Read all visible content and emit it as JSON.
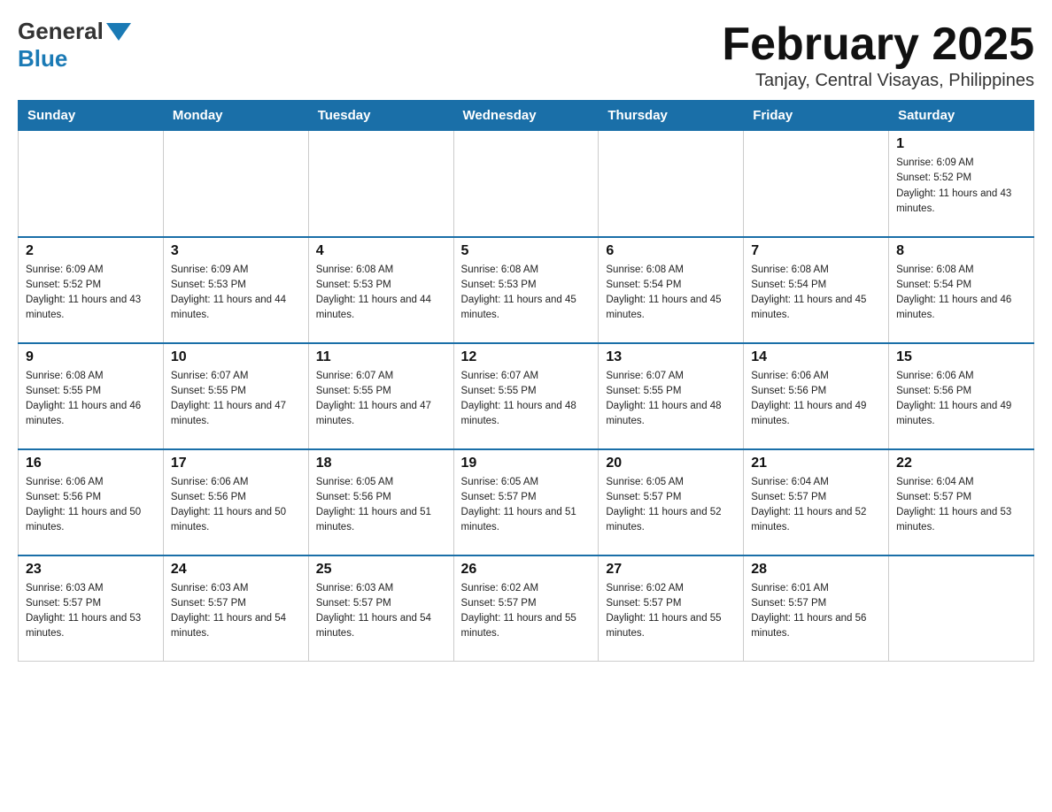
{
  "header": {
    "logo": {
      "general": "General",
      "blue": "Blue"
    },
    "title": "February 2025",
    "location": "Tanjay, Central Visayas, Philippines"
  },
  "days_of_week": [
    "Sunday",
    "Monday",
    "Tuesday",
    "Wednesday",
    "Thursday",
    "Friday",
    "Saturday"
  ],
  "weeks": [
    [
      {
        "day": "",
        "info": ""
      },
      {
        "day": "",
        "info": ""
      },
      {
        "day": "",
        "info": ""
      },
      {
        "day": "",
        "info": ""
      },
      {
        "day": "",
        "info": ""
      },
      {
        "day": "",
        "info": ""
      },
      {
        "day": "1",
        "info": "Sunrise: 6:09 AM\nSunset: 5:52 PM\nDaylight: 11 hours and 43 minutes."
      }
    ],
    [
      {
        "day": "2",
        "info": "Sunrise: 6:09 AM\nSunset: 5:52 PM\nDaylight: 11 hours and 43 minutes."
      },
      {
        "day": "3",
        "info": "Sunrise: 6:09 AM\nSunset: 5:53 PM\nDaylight: 11 hours and 44 minutes."
      },
      {
        "day": "4",
        "info": "Sunrise: 6:08 AM\nSunset: 5:53 PM\nDaylight: 11 hours and 44 minutes."
      },
      {
        "day": "5",
        "info": "Sunrise: 6:08 AM\nSunset: 5:53 PM\nDaylight: 11 hours and 45 minutes."
      },
      {
        "day": "6",
        "info": "Sunrise: 6:08 AM\nSunset: 5:54 PM\nDaylight: 11 hours and 45 minutes."
      },
      {
        "day": "7",
        "info": "Sunrise: 6:08 AM\nSunset: 5:54 PM\nDaylight: 11 hours and 45 minutes."
      },
      {
        "day": "8",
        "info": "Sunrise: 6:08 AM\nSunset: 5:54 PM\nDaylight: 11 hours and 46 minutes."
      }
    ],
    [
      {
        "day": "9",
        "info": "Sunrise: 6:08 AM\nSunset: 5:55 PM\nDaylight: 11 hours and 46 minutes."
      },
      {
        "day": "10",
        "info": "Sunrise: 6:07 AM\nSunset: 5:55 PM\nDaylight: 11 hours and 47 minutes."
      },
      {
        "day": "11",
        "info": "Sunrise: 6:07 AM\nSunset: 5:55 PM\nDaylight: 11 hours and 47 minutes."
      },
      {
        "day": "12",
        "info": "Sunrise: 6:07 AM\nSunset: 5:55 PM\nDaylight: 11 hours and 48 minutes."
      },
      {
        "day": "13",
        "info": "Sunrise: 6:07 AM\nSunset: 5:55 PM\nDaylight: 11 hours and 48 minutes."
      },
      {
        "day": "14",
        "info": "Sunrise: 6:06 AM\nSunset: 5:56 PM\nDaylight: 11 hours and 49 minutes."
      },
      {
        "day": "15",
        "info": "Sunrise: 6:06 AM\nSunset: 5:56 PM\nDaylight: 11 hours and 49 minutes."
      }
    ],
    [
      {
        "day": "16",
        "info": "Sunrise: 6:06 AM\nSunset: 5:56 PM\nDaylight: 11 hours and 50 minutes."
      },
      {
        "day": "17",
        "info": "Sunrise: 6:06 AM\nSunset: 5:56 PM\nDaylight: 11 hours and 50 minutes."
      },
      {
        "day": "18",
        "info": "Sunrise: 6:05 AM\nSunset: 5:56 PM\nDaylight: 11 hours and 51 minutes."
      },
      {
        "day": "19",
        "info": "Sunrise: 6:05 AM\nSunset: 5:57 PM\nDaylight: 11 hours and 51 minutes."
      },
      {
        "day": "20",
        "info": "Sunrise: 6:05 AM\nSunset: 5:57 PM\nDaylight: 11 hours and 52 minutes."
      },
      {
        "day": "21",
        "info": "Sunrise: 6:04 AM\nSunset: 5:57 PM\nDaylight: 11 hours and 52 minutes."
      },
      {
        "day": "22",
        "info": "Sunrise: 6:04 AM\nSunset: 5:57 PM\nDaylight: 11 hours and 53 minutes."
      }
    ],
    [
      {
        "day": "23",
        "info": "Sunrise: 6:03 AM\nSunset: 5:57 PM\nDaylight: 11 hours and 53 minutes."
      },
      {
        "day": "24",
        "info": "Sunrise: 6:03 AM\nSunset: 5:57 PM\nDaylight: 11 hours and 54 minutes."
      },
      {
        "day": "25",
        "info": "Sunrise: 6:03 AM\nSunset: 5:57 PM\nDaylight: 11 hours and 54 minutes."
      },
      {
        "day": "26",
        "info": "Sunrise: 6:02 AM\nSunset: 5:57 PM\nDaylight: 11 hours and 55 minutes."
      },
      {
        "day": "27",
        "info": "Sunrise: 6:02 AM\nSunset: 5:57 PM\nDaylight: 11 hours and 55 minutes."
      },
      {
        "day": "28",
        "info": "Sunrise: 6:01 AM\nSunset: 5:57 PM\nDaylight: 11 hours and 56 minutes."
      },
      {
        "day": "",
        "info": ""
      }
    ]
  ]
}
